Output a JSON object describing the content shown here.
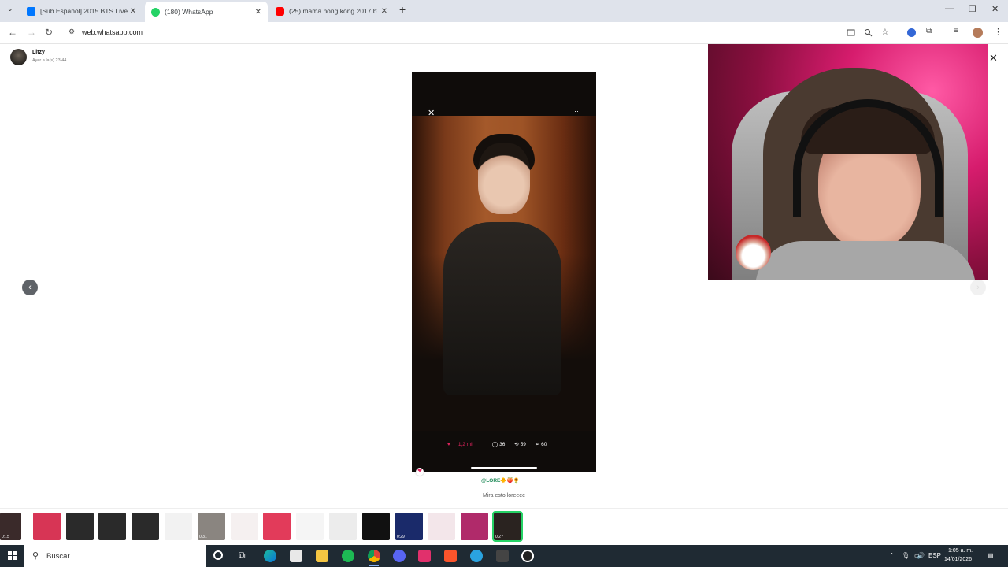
{
  "browser": {
    "tabs": [
      {
        "label": "[Sub Español] 2015 BTS Live Tri",
        "favicon": "vk-icon",
        "color": "#0077ff",
        "active": false
      },
      {
        "label": "(180) WhatsApp",
        "favicon": "whatsapp-icon",
        "color": "#25d366",
        "active": true
      },
      {
        "label": "(25) mama hong kong 2017 bts",
        "favicon": "youtube-icon",
        "color": "#ff0000",
        "active": false
      }
    ],
    "new_tab": "+",
    "url": "web.whatsapp.com"
  },
  "status": {
    "sender_name": "Litzy",
    "sent_time": "Ayer a la(s) 23:44",
    "close": "✕",
    "prev": "‹",
    "next": "›"
  },
  "media": {
    "close": "✕",
    "more": "···",
    "likes": "1,2 mil",
    "comments": "36",
    "reposts": "59",
    "shares": "60",
    "reaction": "❤"
  },
  "caption": {
    "mention": "@LORE🐥🍑🌻",
    "text": "Mira esto loreeee"
  },
  "thumbnails": [
    {
      "dur": "0:15",
      "color": "#3a2a2a"
    },
    {
      "dur": "",
      "color": "#d73555"
    },
    {
      "dur": "",
      "color": "#2a2a2a"
    },
    {
      "dur": "",
      "color": "#2a2a2a"
    },
    {
      "dur": "",
      "color": "#2a2a2a"
    },
    {
      "dur": "",
      "color": "#f2f2f2"
    },
    {
      "dur": "0:31",
      "color": "#8a8580"
    },
    {
      "dur": "",
      "color": "#f5f0f0"
    },
    {
      "dur": "",
      "color": "#e23b5a"
    },
    {
      "dur": "",
      "color": "#f5f5f5"
    },
    {
      "dur": "",
      "color": "#ececec"
    },
    {
      "dur": "",
      "color": "#111111"
    },
    {
      "dur": "0:29",
      "color": "#1a2a6a"
    },
    {
      "dur": "",
      "color": "#f3e6ea"
    },
    {
      "dur": "",
      "color": "#b02a6a"
    },
    {
      "dur": "0:2?",
      "color": "#2a2320",
      "selected": true
    }
  ],
  "taskbar": {
    "search_label": "Buscar",
    "language": "ESP",
    "time": "1:05 a. m.",
    "date": "14/01/2026"
  }
}
